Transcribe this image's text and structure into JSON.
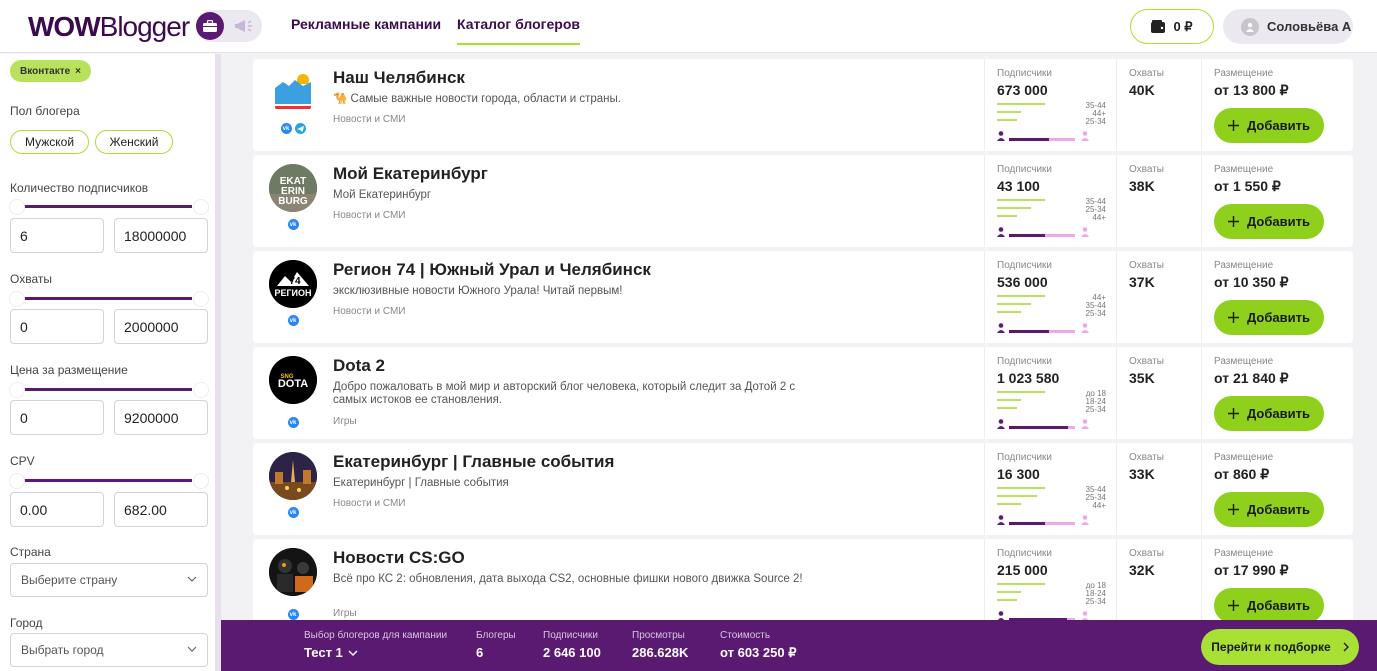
{
  "header": {
    "logo_bold": "WOW",
    "logo_rest": "Blogger",
    "nav": [
      "Рекламные кампании",
      "Каталог блогеров"
    ],
    "wallet": "0 ₽",
    "user": "Соловьёва А"
  },
  "filters": {
    "chip": "Вконтакте",
    "gender_label": "Пол блогера",
    "gender_options": [
      "Мужской",
      "Женский"
    ],
    "subs_label": "Количество подписчиков",
    "subs_min": "6",
    "subs_max": "18000000",
    "reach_label": "Охваты",
    "reach_min": "0",
    "reach_max": "2000000",
    "price_label": "Цена за размещение",
    "price_min": "0",
    "price_max": "9200000",
    "cpv_label": "CPV",
    "cpv_min": "0.00",
    "cpv_max": "682.00",
    "country_label": "Страна",
    "country_placeholder": "Выберите страну",
    "city_label": "Город",
    "city_placeholder": "Выбрать город"
  },
  "labels": {
    "subscribers": "Подписчики",
    "reach": "Охваты",
    "placement": "Размещение",
    "add": "Добавить"
  },
  "bloggers": [
    {
      "name": "Наш Челябинск",
      "desc": "🐪 Самые важные новости города, области и страны.",
      "category": "Новости и СМИ",
      "subs": "673 000",
      "reach": "40K",
      "price": "от 13 800 ₽",
      "ages": [
        "35-44",
        "44+",
        "25-34"
      ],
      "male_share": 0.6,
      "socials": [
        "vk",
        "tg"
      ]
    },
    {
      "name": "Мой Екатеринбург",
      "desc": "Мой Екатеринбург",
      "category": "Новости и СМИ",
      "subs": "43 100",
      "reach": "38K",
      "price": "от 1 550 ₽",
      "ages": [
        "35-44",
        "25-34",
        "44+"
      ],
      "male_share": 0.55,
      "socials": [
        "vk"
      ]
    },
    {
      "name": "Регион 74 | Южный Урал и Челябинск",
      "desc": "эксклюзивные новости Южного Урала! Читай первым!",
      "category": "Новости и СМИ",
      "subs": "536 000",
      "reach": "37K",
      "price": "от 10 350 ₽",
      "ages": [
        "44+",
        "35-44",
        "25-34"
      ],
      "male_share": 0.6,
      "socials": [
        "vk"
      ]
    },
    {
      "name": "Dota 2",
      "desc": "Добро пожаловать в мой мир и авторский блог человека, который следит за Дотой 2 с самых истоков ее становления.",
      "category": "Игры",
      "subs": "1 023 580",
      "reach": "35K",
      "price": "от 21 840 ₽",
      "ages": [
        "до 18",
        "18-24",
        "25-34"
      ],
      "male_share": 0.9,
      "socials": [
        "vk"
      ]
    },
    {
      "name": "Екатеринбург | Главные события",
      "desc": "Екатеринбург | Главные события",
      "category": "Новости и СМИ",
      "subs": "16 300",
      "reach": "33K",
      "price": "от 860 ₽",
      "ages": [
        "35-44",
        "25-34",
        "44+"
      ],
      "male_share": 0.55,
      "socials": [
        "vk"
      ]
    },
    {
      "name": "Новости CS:GO",
      "desc": "Всё про КС 2: обновления, дата выхода CS2, основные фишки нового движка Source 2!",
      "category": "Игры",
      "subs": "215 000",
      "reach": "32K",
      "price": "от 17 990 ₽",
      "ages": [
        "до 18",
        "18-24",
        "25-34"
      ],
      "male_share": 0.88,
      "socials": [
        "vk"
      ]
    }
  ],
  "footer": {
    "campaign_label": "Выбор блогеров для кампании",
    "campaign_value": "Тест 1",
    "bloggers_label": "Блогеры",
    "bloggers_value": "6",
    "subs_label": "Подписчики",
    "subs_value": "2 646 100",
    "views_label": "Просмотры",
    "views_value": "286.628K",
    "cost_label": "Стоимость",
    "cost_value": "от 603 250 ₽",
    "go_label": "Перейти к подборке"
  },
  "colors": {
    "brand": "#5a1a72",
    "accent": "#8ed01c"
  }
}
